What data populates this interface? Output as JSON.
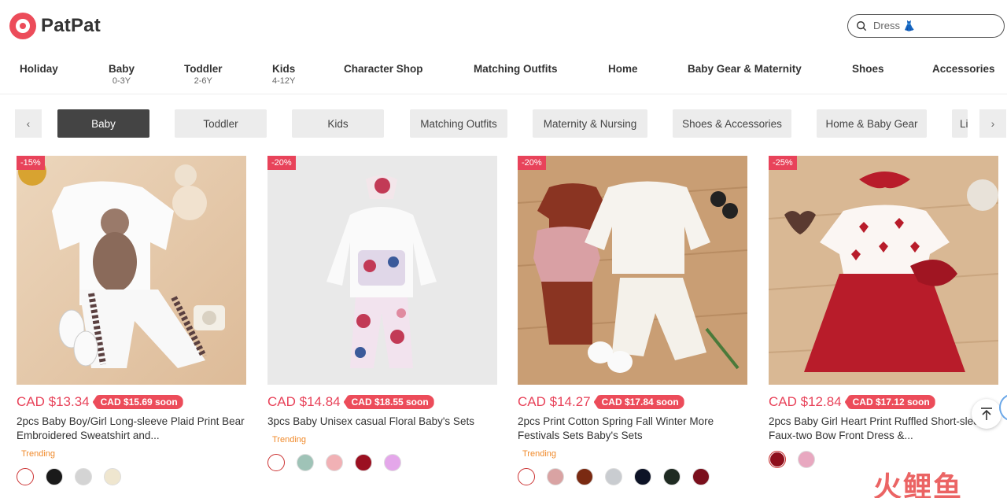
{
  "header": {
    "logo_text": "PatPat",
    "search_value": "Dress 👗"
  },
  "mainnav": [
    {
      "label": "Holiday",
      "sub": ""
    },
    {
      "label": "Baby",
      "sub": "0-3Y"
    },
    {
      "label": "Toddler",
      "sub": "2-6Y"
    },
    {
      "label": "Kids",
      "sub": "4-12Y"
    },
    {
      "label": "Character Shop",
      "sub": ""
    },
    {
      "label": "Matching Outfits",
      "sub": ""
    },
    {
      "label": "Home",
      "sub": ""
    },
    {
      "label": "Baby Gear & Maternity",
      "sub": ""
    },
    {
      "label": "Shoes",
      "sub": ""
    },
    {
      "label": "Accessories",
      "sub": ""
    }
  ],
  "pills": {
    "prev": "‹",
    "next": "›",
    "items": [
      "Baby",
      "Toddler",
      "Kids",
      "Matching Outfits",
      "Maternity & Nursing",
      "Shoes & Accessories",
      "Home & Baby Gear",
      "Li"
    ]
  },
  "products": [
    {
      "badge": "-15%",
      "price": "CAD $13.34",
      "soon": "CAD $15.69 soon",
      "title": "2pcs Baby Boy/Girl Long-sleeve Plaid Print Bear Embroidered Sweatshirt and...",
      "trending": "Trending",
      "swatches": [
        "#ffffff",
        "#1a1a1a",
        "#d4d4d4",
        "#efe6cf"
      ]
    },
    {
      "badge": "-20%",
      "price": "CAD $14.84",
      "soon": "CAD $18.55 soon",
      "title": "3pcs Baby Unisex casual Floral Baby's Sets",
      "trending": "Trending",
      "swatches": [
        "#ffffff",
        "#9fc3b7",
        "#f1b1b5",
        "#9b1021",
        "#e4a7ea"
      ]
    },
    {
      "badge": "-20%",
      "price": "CAD $14.27",
      "soon": "CAD $17.84 soon",
      "title": "2pcs Print Cotton Spring Fall Winter More Festivals Sets Baby's Sets",
      "trending": "Trending",
      "swatches": [
        "#ffffff",
        "#d9a3a3",
        "#7a2a12",
        "#c9ccd0",
        "#0d1326",
        "#1f2b22",
        "#7a0f1c"
      ]
    },
    {
      "badge": "-25%",
      "price": "CAD $12.84",
      "soon": "CAD $17.12 soon",
      "title": "2pcs Baby Girl Heart Print Ruffled Short-sleeve Faux-two Bow Front Dress &...",
      "trending": "",
      "swatches": [
        "#8e0f1c",
        "#e8a8c0"
      ]
    }
  ],
  "watermark": "火鲤鱼"
}
